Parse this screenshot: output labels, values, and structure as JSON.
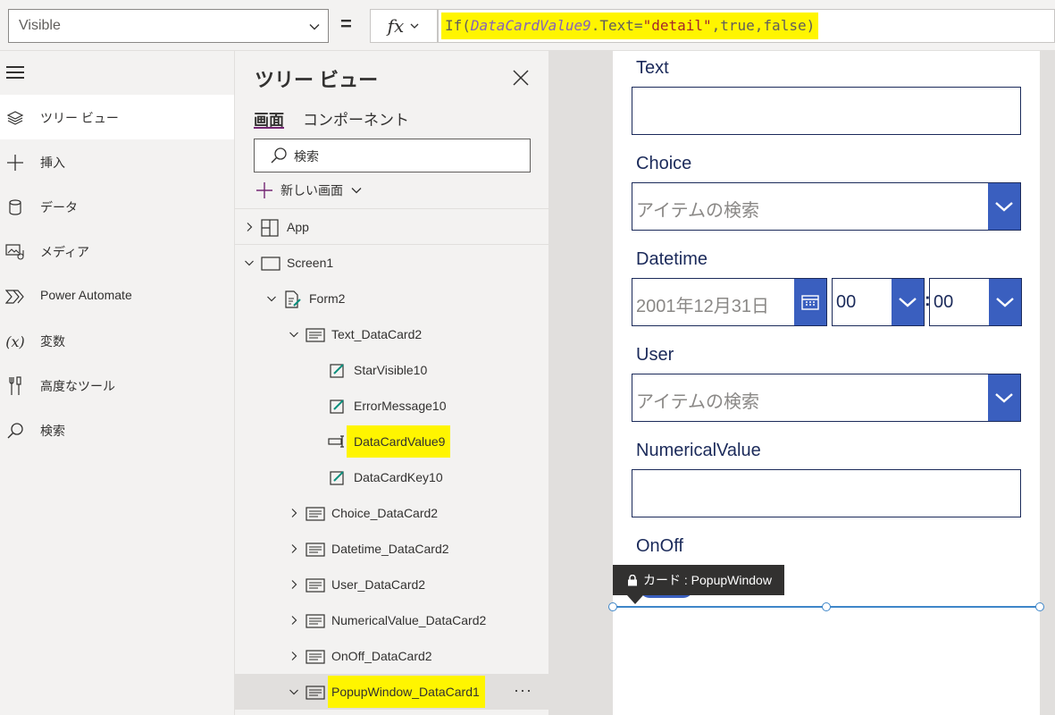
{
  "formula_bar": {
    "property": "Visible",
    "fx_label": "fx",
    "formula": {
      "fn": "If(",
      "ref": "DataCardValue9",
      "mid": ".Text=",
      "str": "\"detail\"",
      "tail": ",true,false)"
    },
    "equals": "="
  },
  "left_nav": {
    "items": [
      {
        "label": "ツリー ビュー",
        "icon": "layers-icon"
      },
      {
        "label": "挿入",
        "icon": "plus-icon"
      },
      {
        "label": "データ",
        "icon": "database-icon"
      },
      {
        "label": "メディア",
        "icon": "media-icon"
      },
      {
        "label": "Power Automate",
        "icon": "power-automate-icon"
      },
      {
        "label": "変数",
        "icon": "variable-icon"
      },
      {
        "label": "高度なツール",
        "icon": "tools-icon"
      },
      {
        "label": "検索",
        "icon": "search-icon"
      }
    ]
  },
  "tree_view": {
    "title": "ツリー ビュー",
    "tabs": [
      "画面",
      "コンポーネント"
    ],
    "search_placeholder": "検索",
    "new_screen": "新しい画面",
    "more": "···",
    "nodes": [
      {
        "label": "App",
        "icon": "app-icon",
        "expanded": false
      },
      {
        "label": "Screen1",
        "icon": "screen-icon",
        "expanded": true
      },
      {
        "label": "Form2",
        "icon": "form-icon",
        "expanded": true
      },
      {
        "label": "Text_DataCard2",
        "icon": "card-icon",
        "expanded": true
      },
      {
        "label": "StarVisible10",
        "icon": "label-icon"
      },
      {
        "label": "ErrorMessage10",
        "icon": "label-icon"
      },
      {
        "label": "DataCardValue9",
        "icon": "textinput-icon",
        "highlighted": true
      },
      {
        "label": "DataCardKey10",
        "icon": "label-icon"
      },
      {
        "label": "Choice_DataCard2",
        "icon": "card-icon",
        "expanded": false
      },
      {
        "label": "Datetime_DataCard2",
        "icon": "card-icon",
        "expanded": false
      },
      {
        "label": "User_DataCard2",
        "icon": "card-icon",
        "expanded": false
      },
      {
        "label": "NumericalValue_DataCard2",
        "icon": "card-icon",
        "expanded": false
      },
      {
        "label": "OnOff_DataCard2",
        "icon": "card-icon",
        "expanded": false
      },
      {
        "label": "PopupWindow_DataCard1",
        "icon": "card-icon",
        "expanded": true,
        "highlighted": true,
        "selected": true
      }
    ]
  },
  "canvas": {
    "fields": {
      "text": "Text",
      "choice": "Choice",
      "datetime": "Datetime",
      "user": "User",
      "numerical": "NumericalValue",
      "onoff": "OnOff"
    },
    "choice_placeholder": "アイテムの検索",
    "user_placeholder": "アイテムの検索",
    "date_value": "2001年12月31日",
    "hour_value": "00",
    "minute_value": "00",
    "time_separator": ":",
    "tooltip": "カード : PopupWindow"
  },
  "colors": {
    "accent": "#742774",
    "highlight": "#fff500",
    "control_blue": "#3a5fbf",
    "label_navy": "#1b2a5a",
    "selection": "#3e86c9"
  }
}
